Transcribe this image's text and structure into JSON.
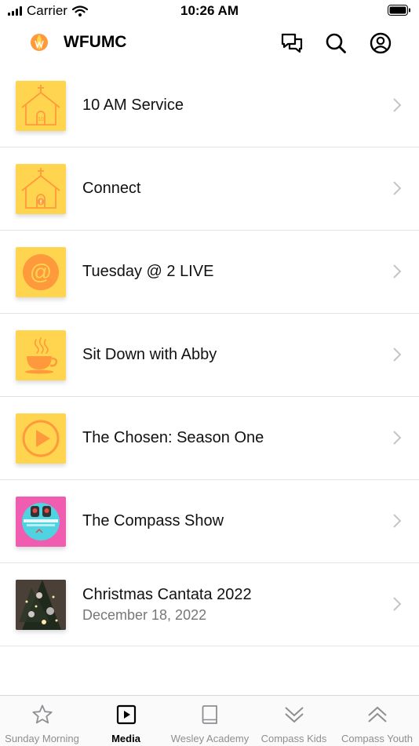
{
  "status_bar": {
    "carrier": "Carrier",
    "time": "10:26 AM"
  },
  "header": {
    "title": "WFUMC"
  },
  "media_items": [
    {
      "title": "10 AM Service",
      "subtitle": "",
      "icon": "church-icon"
    },
    {
      "title": "Connect",
      "subtitle": "",
      "icon": "church-facebook-icon"
    },
    {
      "title": "Tuesday @ 2 LIVE",
      "subtitle": "",
      "icon": "at-sign-icon"
    },
    {
      "title": "Sit Down with Abby",
      "subtitle": "",
      "icon": "coffee-cup-icon"
    },
    {
      "title": "The Chosen: Season One",
      "subtitle": "",
      "icon": "play-circle-icon"
    },
    {
      "title": "The Compass Show",
      "subtitle": "",
      "icon": "compass-show-artwork"
    },
    {
      "title": "Christmas Cantata 2022",
      "subtitle": "December 18, 2022",
      "icon": "christmas-tree-photo"
    }
  ],
  "tabs": [
    {
      "label": "Sunday Morning",
      "icon": "star-icon",
      "active": false
    },
    {
      "label": "Media",
      "icon": "play-square-icon",
      "active": true
    },
    {
      "label": "Wesley Academy",
      "icon": "book-icon",
      "active": false
    },
    {
      "label": "Compass Kids",
      "icon": "double-chevron-down-icon",
      "active": false
    },
    {
      "label": "Compass Youth",
      "icon": "double-chevron-up-icon",
      "active": false
    }
  ],
  "colors": {
    "thumb_yellow": "#FFD54F",
    "thumb_orange": "#FF9A3C",
    "thumb_pink": "#F05DB0",
    "thumb_cyan": "#4FD3E0",
    "inactive_tab": "#8e8e93"
  }
}
